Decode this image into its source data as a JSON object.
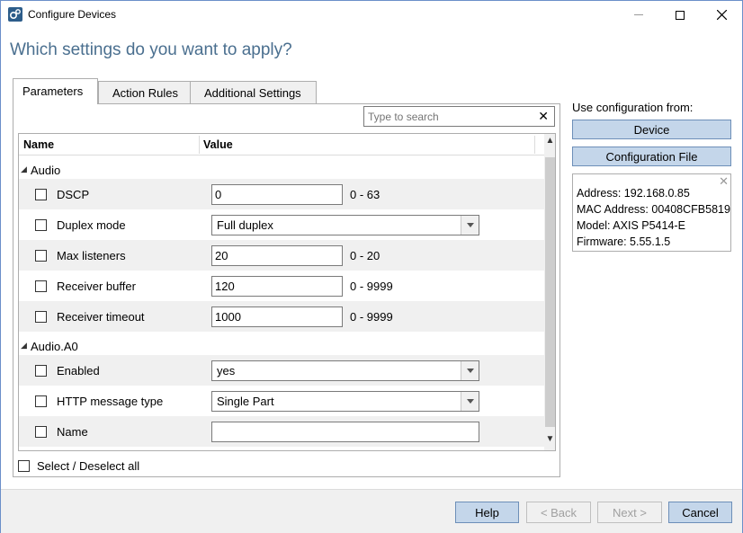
{
  "window": {
    "title": "Configure Devices",
    "heading": "Which settings do you want to apply?"
  },
  "tabs": [
    {
      "label": "Parameters",
      "active": true
    },
    {
      "label": "Action Rules",
      "active": false
    },
    {
      "label": "Additional Settings",
      "active": false
    }
  ],
  "search": {
    "placeholder": "Type to search",
    "value": ""
  },
  "grid": {
    "columns": {
      "name": "Name",
      "value": "Value"
    },
    "groups": [
      {
        "name": "Audio",
        "rows": [
          {
            "label": "DSCP",
            "type": "text",
            "value": "0",
            "range": "0 - 63"
          },
          {
            "label": "Duplex mode",
            "type": "dropdown",
            "value": "Full duplex",
            "range": ""
          },
          {
            "label": "Max listeners",
            "type": "text",
            "value": "20",
            "range": "0 - 20"
          },
          {
            "label": "Receiver buffer",
            "type": "text",
            "value": "120",
            "range": "0 - 9999"
          },
          {
            "label": "Receiver timeout",
            "type": "text",
            "value": "1000",
            "range": "0 - 9999"
          }
        ]
      },
      {
        "name": "Audio.A0",
        "rows": [
          {
            "label": "Enabled",
            "type": "dropdown",
            "value": "yes",
            "range": ""
          },
          {
            "label": "HTTP message type",
            "type": "dropdown",
            "value": "Single Part",
            "range": ""
          },
          {
            "label": "Name",
            "type": "text-wide",
            "value": "",
            "range": ""
          }
        ]
      }
    ]
  },
  "select_all_label": "Select / Deselect all",
  "side": {
    "label": "Use configuration from:",
    "device_button": "Device",
    "config_button": "Configuration File",
    "info": {
      "address": "Address: 192.168.0.85",
      "mac": "MAC Address: 00408CFB5819",
      "model": "Model: AXIS P5414-E",
      "firmware": "Firmware: 5.55.1.5"
    }
  },
  "footer": {
    "help": "Help",
    "back": "< Back",
    "next": "Next >",
    "cancel": "Cancel"
  },
  "colors": {
    "accent": "#4a6f8f",
    "button_bg": "#c4d6ea",
    "button_border": "#6d8fb8"
  }
}
